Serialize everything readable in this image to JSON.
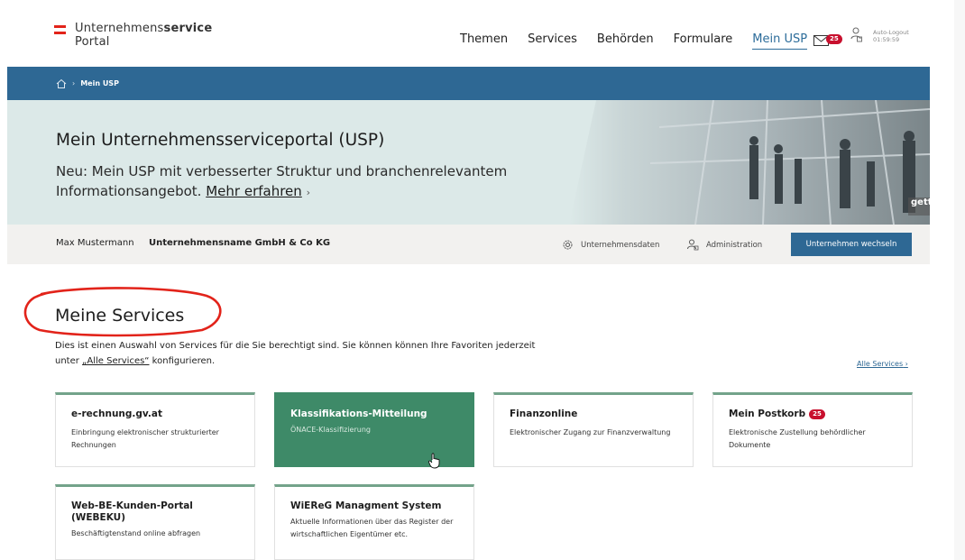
{
  "header": {
    "logo_line1_prefix": "Unternehmens",
    "logo_line1_bold": "service",
    "logo_line2": "Portal",
    "nav": [
      "Themen",
      "Services",
      "Behörden",
      "Formulare",
      "Mein USP"
    ],
    "mail_badge": "25",
    "autologout_label": "Auto-Logout",
    "autologout_time": "01:59:59"
  },
  "breadcrumb": {
    "current": "Mein USP"
  },
  "hero": {
    "title": "Mein Unternehmensserviceportal (USP)",
    "subtitle": "Neu: Mein USP mit verbesserter Struktur und branchenrelevantem Informationsangebot.",
    "link": "Mehr erfahren",
    "photo_credit": "getty"
  },
  "user_bar": {
    "user_name": "Max Mustermann",
    "company": "Unternehmensname GmbH & Co KG",
    "company_data_link": "Unternehmensdaten",
    "admin_link": "Administration",
    "switch_button": "Unternehmen wechseln"
  },
  "services": {
    "title": "Meine Services",
    "desc_line1": "Dies ist einen Auswahl von Services für die Sie berechtigt sind. Sie können können Ihre Favoriten jederzeit",
    "desc_line2_prefix": "unter ",
    "desc_line2_link": "„Alle Services“",
    "desc_line2_suffix": " konfigurieren.",
    "all_services_link": "Alle Services",
    "cards": [
      {
        "title": "e-rechnung.gv.at",
        "desc": "Einbringung elektronischer strukturierter Rechnungen"
      },
      {
        "title": "Klassifikations-Mitteilung",
        "desc": "ÖNACE-Klassifizierung"
      },
      {
        "title": "Finanzonline",
        "desc": "Elektronischer Zugang zur Finanzverwaltung"
      },
      {
        "title": "Mein Postkorb",
        "badge": "25",
        "desc": "Elektronische Zustellung behördlicher Dokumente"
      },
      {
        "title": "Web-BE-Kunden-Portal (WEBEKU)",
        "desc": "Beschäftigtenstand online abfragen"
      },
      {
        "title": "WiEReG Managment System",
        "desc": "Aktuelle Informationen über das Register der wirtschaftlichen Eigentümer etc."
      }
    ]
  },
  "colors": {
    "primary_blue": "#2e6894",
    "card_green": "#3e8a68",
    "card_accent": "#73a38a",
    "hero_bg": "#dce9e8",
    "badge_red": "#c8102e",
    "annotation_red": "#e2231a"
  }
}
